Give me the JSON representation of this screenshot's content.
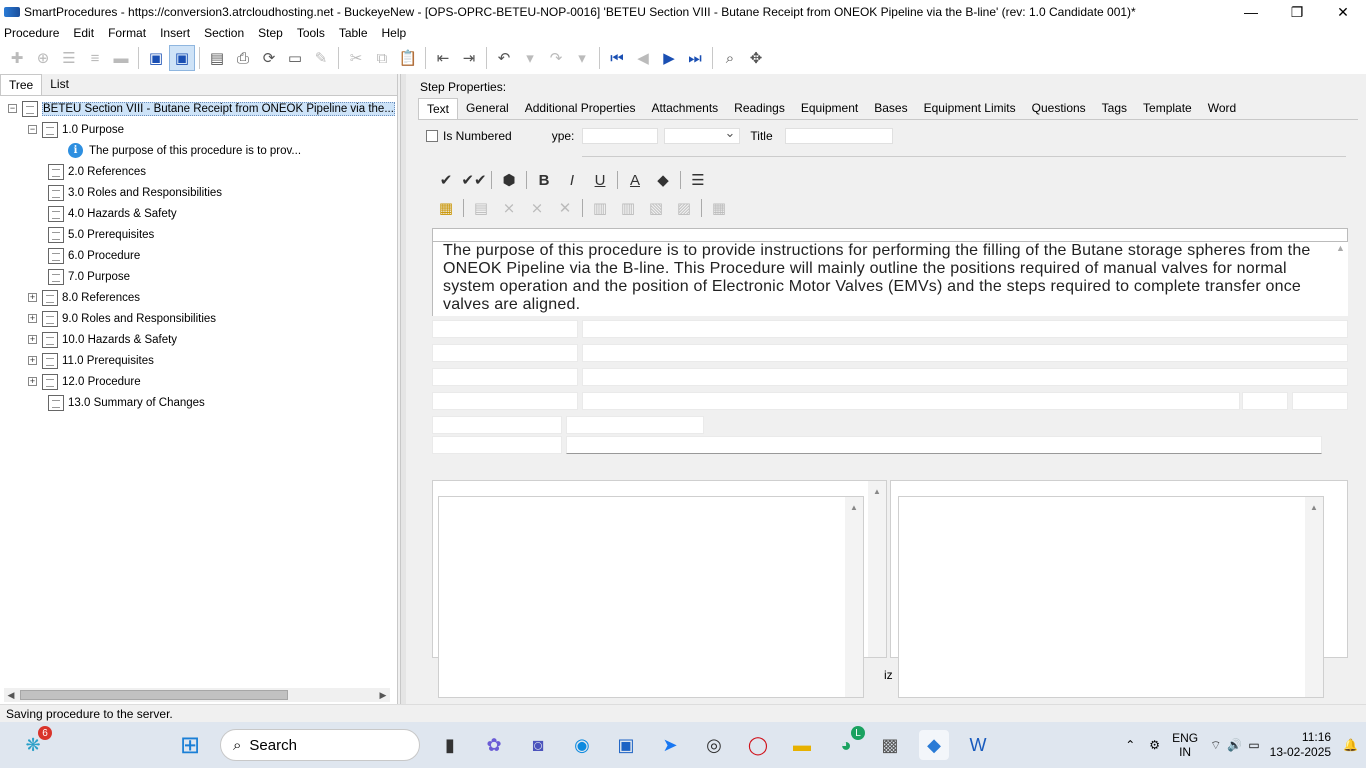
{
  "window": {
    "title": "SmartProcedures - https://conversion3.atrcloudhosting.net - BuckeyeNew - [OPS-OPRC-BETEU-NOP-0016] 'BETEU Section VIII - Butane Receipt from ONEOK Pipeline via the B-line' (rev: 1.0 Candidate 001)*",
    "minimize": "—",
    "maximize": "❐",
    "close": "✕"
  },
  "menu": [
    "Procedure",
    "Edit",
    "Format",
    "Insert",
    "Section",
    "Step",
    "Tools",
    "Table",
    "Help"
  ],
  "left_tabs": [
    "Tree",
    "List"
  ],
  "tree": {
    "root": "BETEU Section VIII - Butane Receipt from ONEOK Pipeline via the...",
    "purpose": "1.0 Purpose",
    "purpose_child": "The purpose of this procedure is to prov...",
    "items": [
      "2.0 References",
      "3.0 Roles and Responsibilities",
      "4.0 Hazards & Safety",
      "5.0 Prerequisites",
      "6.0 Procedure",
      "7.0 Purpose",
      "8.0 References",
      "9.0 Roles and Responsibilities",
      "10.0 Hazards & Safety",
      "11.0 Prerequisites",
      "12.0 Procedure",
      "13.0 Summary of Changes"
    ]
  },
  "step_properties": {
    "title": "Step Properties:",
    "tabs": [
      "Text",
      "General",
      "Additional Properties",
      "Attachments",
      "Readings",
      "Equipment",
      "Bases",
      "Equipment Limits",
      "Questions",
      "Tags",
      "Template",
      "Word"
    ],
    "is_numbered_label": "Is Numbered",
    "type_label": "ype:",
    "title_label": "Title",
    "editor_text": "The purpose of this procedure is to provide instructions for performing the filling of the Butane storage spheres from the ONEOK Pipeline via the B-line. This Procedure will mainly outline the positions required of manual valves for normal system operation and the position of Electronic Motor Valves (EMVs) and the steps required to complete transfer once valves are aligned.",
    "fragment": "iz"
  },
  "status": "Saving procedure to the server.",
  "taskbar": {
    "search": "Search",
    "notif_count": "6",
    "chrome_badge": "L",
    "lang_top": "ENG",
    "lang_bottom": "IN",
    "time": "11:16",
    "date": "13-02-2025"
  }
}
